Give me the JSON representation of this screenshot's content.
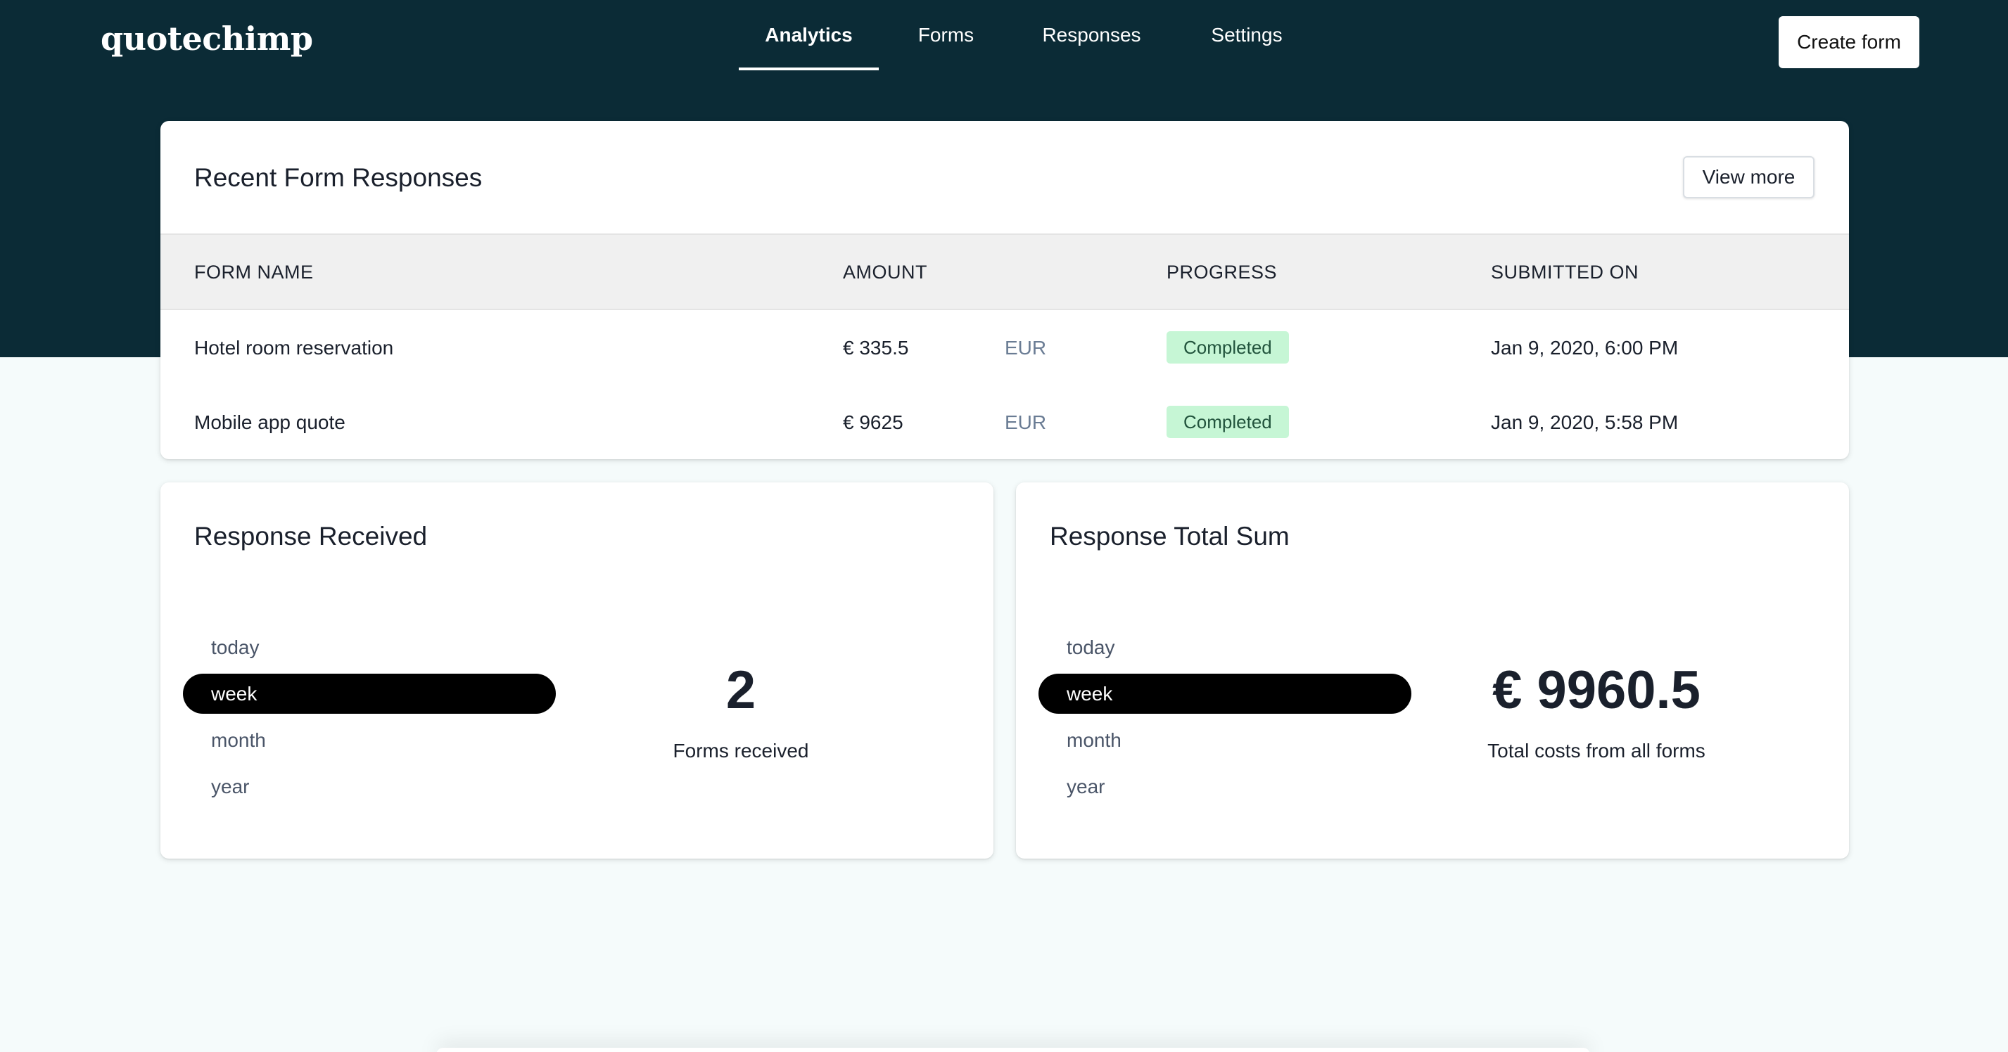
{
  "app": {
    "logo": "quotechimp"
  },
  "nav": {
    "items": [
      {
        "label": "Analytics",
        "active": true
      },
      {
        "label": "Forms",
        "active": false
      },
      {
        "label": "Responses",
        "active": false
      },
      {
        "label": "Settings",
        "active": false
      }
    ],
    "create_button": "Create form"
  },
  "recent": {
    "title": "Recent Form Responses",
    "view_more": "View more",
    "columns": [
      "FORM NAME",
      "AMOUNT",
      "PROGRESS",
      "SUBMITTED ON"
    ],
    "rows": [
      {
        "form_name": "Hotel room reservation",
        "amount": "€ 335.5",
        "currency": "EUR",
        "progress": "Completed",
        "submitted_on": "Jan 9, 2020, 6:00 PM"
      },
      {
        "form_name": "Mobile app quote",
        "amount": "€ 9625",
        "currency": "EUR",
        "progress": "Completed",
        "submitted_on": "Jan 9, 2020, 5:58 PM"
      }
    ]
  },
  "responses_received": {
    "title": "Response Received",
    "periods": [
      "today",
      "week",
      "month",
      "year"
    ],
    "selected_period": "week",
    "value": "2",
    "label": "Forms received"
  },
  "responses_total": {
    "title": "Response Total Sum",
    "periods": [
      "today",
      "week",
      "month",
      "year"
    ],
    "selected_period": "week",
    "value": "€ 9960.5",
    "label": "Total costs from all forms"
  },
  "colors": {
    "header_bg": "#0b2b36",
    "page_bg": "#f5fbfb",
    "badge_bg": "#c6f6d5",
    "badge_text": "#22543d",
    "active_period_bg": "#000000"
  }
}
